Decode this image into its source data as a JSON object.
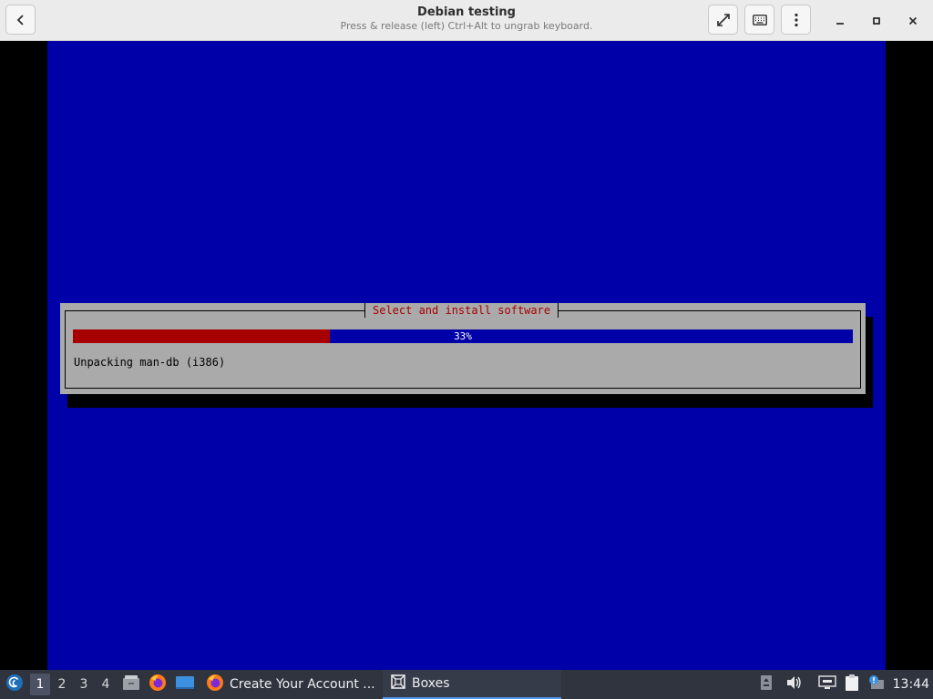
{
  "window": {
    "title": "Debian testing",
    "subtitle": "Press & release (left) Ctrl+Alt to ungrab keyboard."
  },
  "header_icons": {
    "back": "back-arrow-icon",
    "fullscreen": "fullscreen-icon",
    "keyboard": "keyboard-icon",
    "menu": "kebab-menu-icon",
    "minimize": "minimize-icon",
    "maximize": "maximize-icon",
    "close": "close-icon"
  },
  "installer": {
    "dialog_title": "Select and install software",
    "progress_label": "33%",
    "progress_fraction": 0.33,
    "status": "Unpacking man-db (i386)",
    "colors": {
      "screen_bg": "#0000a8",
      "dialog_bg": "#aaaaaa",
      "progress_fill": "#a80000",
      "title_text": "#a80000"
    }
  },
  "taskbar": {
    "workspaces": [
      "1",
      "2",
      "3",
      "4"
    ],
    "active_workspace": "1",
    "launchers": [
      "file-manager-icon",
      "firefox-icon",
      "desktop-icon"
    ],
    "tasks": [
      {
        "label": "Create Your Account ...",
        "icon": "firefox-icon",
        "active": false
      },
      {
        "label": "Boxes",
        "icon": "boxes-icon",
        "active": true
      }
    ],
    "tray": [
      "storage-icon",
      "volume-icon",
      "network-icon",
      "clipboard-icon",
      "notification-icon"
    ],
    "clock": "13:44"
  }
}
